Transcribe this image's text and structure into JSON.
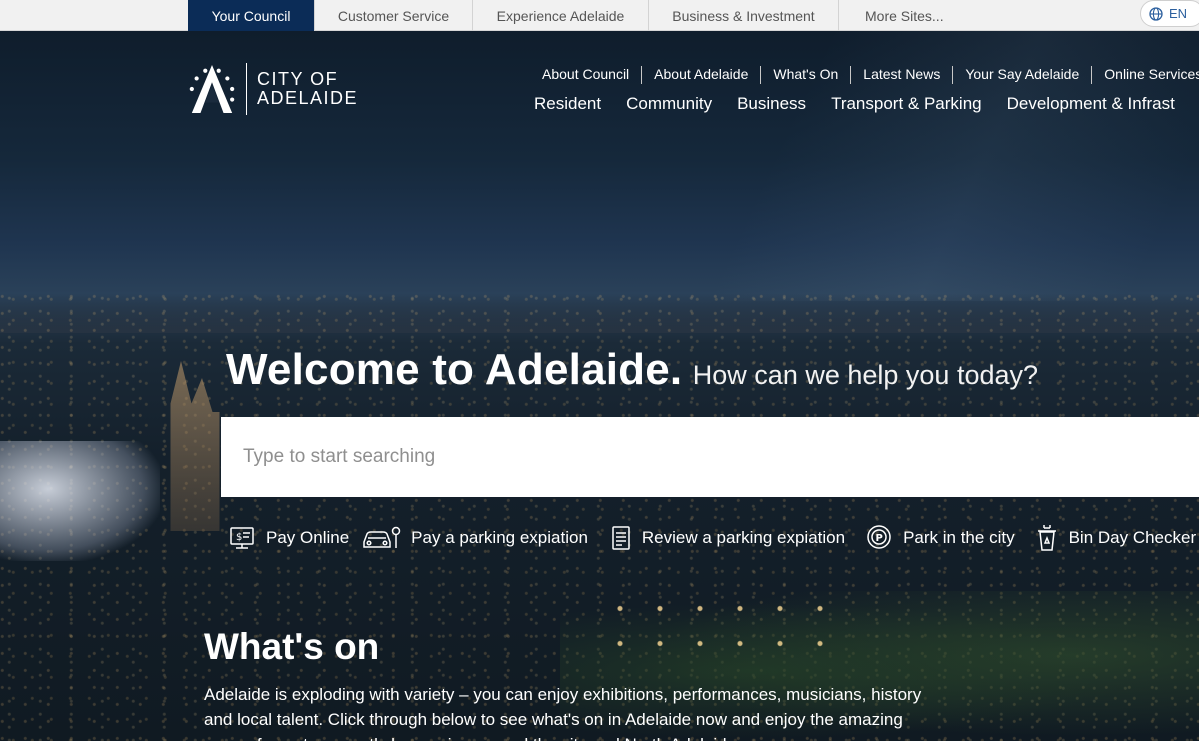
{
  "top_bar": {
    "sites": [
      {
        "label": "Your Council",
        "active": true
      },
      {
        "label": "Customer Service",
        "active": false
      },
      {
        "label": "Experience Adelaide",
        "active": false
      },
      {
        "label": "Business & Investment",
        "active": false
      },
      {
        "label": "More Sites...",
        "active": false
      }
    ],
    "language": {
      "label": "EN",
      "icon": "globe-icon"
    }
  },
  "logo": {
    "line1": "CITY OF",
    "line2": "ADELAIDE",
    "icon": "city-of-adelaide-logo"
  },
  "utility_nav": [
    "About Council",
    "About Adelaide",
    "What's On",
    "Latest News",
    "Your Say Adelaide",
    "Online Services"
  ],
  "main_nav": [
    "Resident",
    "Community",
    "Business",
    "Transport & Parking",
    "Development & Infrast"
  ],
  "hero": {
    "title": "Welcome to Adelaide.",
    "subtitle": "How can we help you today?"
  },
  "search": {
    "placeholder": "Type to start searching",
    "value": ""
  },
  "quick_links": [
    {
      "label": "Pay Online",
      "icon": "payment-screen-icon"
    },
    {
      "label": "Pay a parking expiation",
      "icon": "car-parking-icon"
    },
    {
      "label": "Review a parking expiation",
      "icon": "document-icon"
    },
    {
      "label": "Park in the city",
      "icon": "parking-pin-icon"
    },
    {
      "label": "Bin Day Checker",
      "icon": "recycling-bin-icon"
    }
  ],
  "whats_on": {
    "title": "What's on",
    "text": "Adelaide is exploding with variety – you can enjoy exhibitions, performances, musicians, history and local talent. Click through below to see what's on in Adelaide now and enjoy the amazing array of events currently happening around the city and North Adelaide."
  },
  "colors": {
    "active_tab": "#0b2c57",
    "topbar_bg": "#f1f1f1",
    "hero_text": "#ffffff"
  }
}
